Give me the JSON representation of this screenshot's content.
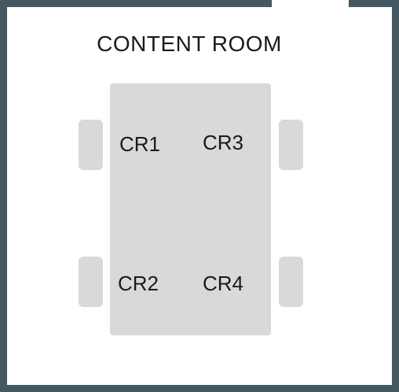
{
  "room": {
    "title": "CONTENT ROOM",
    "wall_color": "#435861",
    "furniture_color": "#d9d9d9"
  },
  "seats": [
    {
      "id": "CR1"
    },
    {
      "id": "CR2"
    },
    {
      "id": "CR3"
    },
    {
      "id": "CR4"
    }
  ]
}
